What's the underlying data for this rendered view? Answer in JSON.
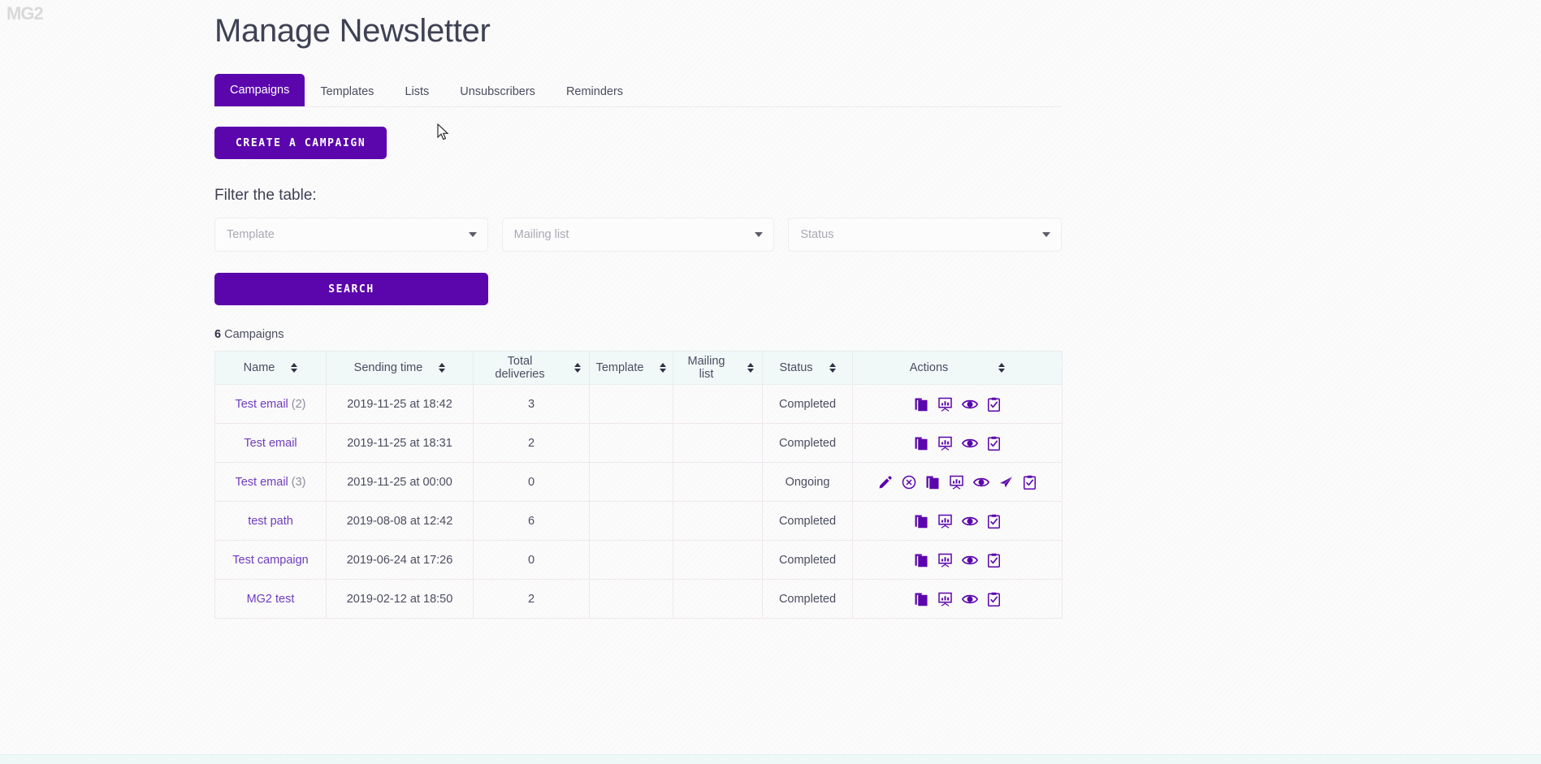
{
  "watermark": "MG2",
  "header": {
    "title": "Manage Newsletter"
  },
  "tabs": [
    {
      "label": "Campaigns",
      "active": true
    },
    {
      "label": "Templates",
      "active": false
    },
    {
      "label": "Lists",
      "active": false
    },
    {
      "label": "Unsubscribers",
      "active": false
    },
    {
      "label": "Reminders",
      "active": false
    }
  ],
  "create_button": {
    "label": "CREATE A CAMPAIGN"
  },
  "filter": {
    "label": "Filter the table:",
    "selects": [
      {
        "name": "template",
        "placeholder": "Template",
        "value": ""
      },
      {
        "name": "mailing-list",
        "placeholder": "Mailing list",
        "value": ""
      },
      {
        "name": "status",
        "placeholder": "Status",
        "value": ""
      }
    ],
    "search_button": {
      "label": "SEARCH"
    }
  },
  "results": {
    "count": "6",
    "count_suffix": " Campaigns"
  },
  "table": {
    "columns": [
      {
        "label": "Name",
        "sortable": true
      },
      {
        "label": "Sending time",
        "sortable": true
      },
      {
        "label": "Total deliveries",
        "sortable": true
      },
      {
        "label": "Template",
        "sortable": true
      },
      {
        "label": "Mailing list",
        "sortable": true
      },
      {
        "label": "Status",
        "sortable": true
      },
      {
        "label": "Actions",
        "sortable": true
      }
    ],
    "rows": [
      {
        "name": "Test email",
        "name_suffix": " (2)",
        "sending_time": "2019-11-25 at 18:42",
        "total_deliveries": "3",
        "template": "",
        "mailing_list": "",
        "status": "Completed",
        "actions": [
          "copy-icon",
          "statistics-icon",
          "preview-icon",
          "clipboard-icon"
        ]
      },
      {
        "name": "Test email",
        "name_suffix": "",
        "sending_time": "2019-11-25 at 18:31",
        "total_deliveries": "2",
        "template": "",
        "mailing_list": "",
        "status": "Completed",
        "actions": [
          "copy-icon",
          "statistics-icon",
          "preview-icon",
          "clipboard-icon"
        ]
      },
      {
        "name": "Test email",
        "name_suffix": " (3)",
        "sending_time": "2019-11-25 at 00:00",
        "total_deliveries": "0",
        "template": "",
        "mailing_list": "",
        "status": "Ongoing",
        "actions": [
          "edit-icon",
          "cancel-icon",
          "copy-icon",
          "statistics-icon",
          "preview-icon",
          "send-icon",
          "clipboard-icon"
        ]
      },
      {
        "name": "test path",
        "name_suffix": "",
        "sending_time": "2019-08-08 at 12:42",
        "total_deliveries": "6",
        "template": "",
        "mailing_list": "",
        "status": "Completed",
        "actions": [
          "copy-icon",
          "statistics-icon",
          "preview-icon",
          "clipboard-icon"
        ]
      },
      {
        "name": "Test campaign",
        "name_suffix": "",
        "sending_time": "2019-06-24 at 17:26",
        "total_deliveries": "0",
        "template": "",
        "mailing_list": "",
        "status": "Completed",
        "actions": [
          "copy-icon",
          "statistics-icon",
          "preview-icon",
          "clipboard-icon"
        ]
      },
      {
        "name": "MG2 test",
        "name_suffix": "",
        "sending_time": "2019-02-12 at 18:50",
        "total_deliveries": "2",
        "template": "",
        "mailing_list": "",
        "status": "Completed",
        "actions": [
          "copy-icon",
          "statistics-icon",
          "preview-icon",
          "clipboard-icon"
        ]
      }
    ]
  },
  "colors": {
    "primary": "#5b06ad",
    "link": "#6f3bbf",
    "header_bg": "#f0f8f8",
    "text": "#4b4d60"
  }
}
